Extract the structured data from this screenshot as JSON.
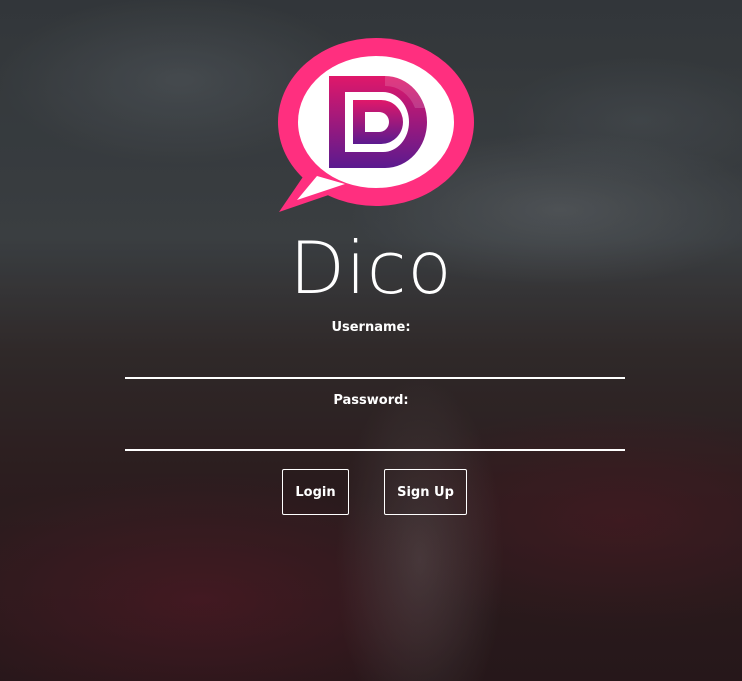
{
  "app": {
    "title": "Dico",
    "logo_letter": "D"
  },
  "form": {
    "username_label": "Username:",
    "username_value": "",
    "password_label": "Password:",
    "password_value": ""
  },
  "buttons": {
    "login_label": "Login",
    "signup_label": "Sign Up"
  },
  "colors": {
    "logo_bubble": "#ff2f7f",
    "logo_gradient_top": "#e0186a",
    "logo_gradient_bottom": "#5b1a8f",
    "text": "#ffffff"
  }
}
